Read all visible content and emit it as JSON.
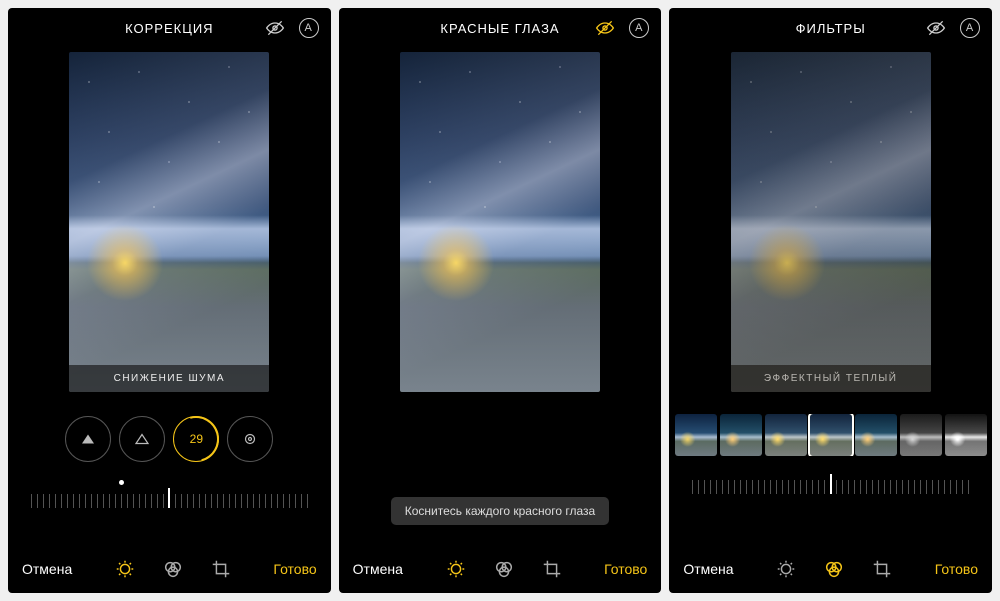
{
  "screens": [
    {
      "header": {
        "title": "КОРРЕКЦИЯ",
        "eye_active": false
      },
      "photo_label": "СНИЖЕНИЕ ШУМА",
      "adjust": {
        "dials": [
          {
            "icon": "triangle-filled"
          },
          {
            "icon": "triangle-outline"
          },
          {
            "icon": "value",
            "value": "29",
            "active": true
          },
          {
            "icon": "target"
          }
        ],
        "ruler_dot_pct": 32
      },
      "footer": {
        "cancel": "Отмена",
        "done": "Готово",
        "active_tool": "adjust"
      }
    },
    {
      "header": {
        "title": "КРАСНЫЕ ГЛАЗА",
        "eye_active": true
      },
      "hint": "Коснитесь каждого красного глаза",
      "footer": {
        "cancel": "Отмена",
        "done": "Готово",
        "active_tool": "adjust"
      }
    },
    {
      "header": {
        "title": "ФИЛЬТРЫ",
        "eye_active": false
      },
      "photo_label": "ЭФФЕКТНЫЙ ТЕПЛЫЙ",
      "filters": {
        "selected_index": 3,
        "count": 7
      },
      "footer": {
        "cancel": "Отмена",
        "done": "Готово",
        "active_tool": "filters"
      }
    }
  ],
  "icons": {
    "markup_letter": "A"
  }
}
